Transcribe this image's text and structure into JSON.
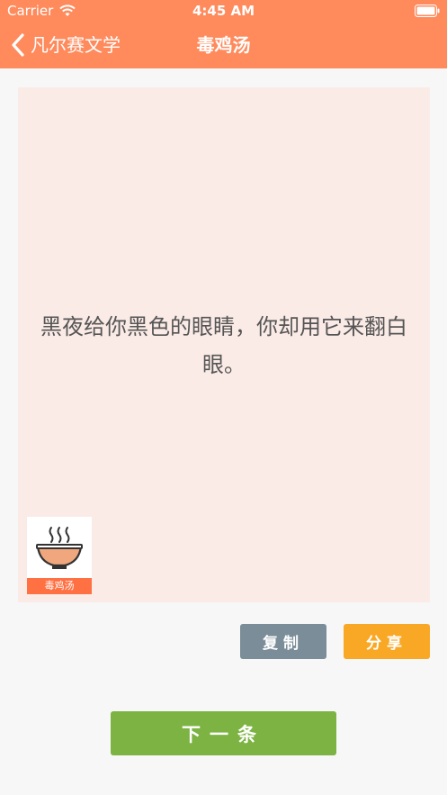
{
  "status_bar": {
    "carrier": "Carrier",
    "time": "4:45 AM"
  },
  "nav": {
    "back_label": "凡尔赛文学",
    "title": "毒鸡汤"
  },
  "quote": {
    "text": "黑夜给你黑色的眼睛，你却用它来翻白眼。"
  },
  "logo": {
    "label": "毒鸡汤"
  },
  "actions": {
    "copy_label": "复制",
    "share_label": "分享",
    "next_label": "下一条"
  },
  "colors": {
    "nav_background": "#ff8a5c",
    "card_background": "#fbebe6",
    "copy_button": "#7a8d98",
    "share_button": "#f9a825",
    "next_button": "#7cb342",
    "logo_band": "#ff7043"
  },
  "icons": {
    "back": "chevron-left-icon",
    "wifi": "wifi-icon",
    "battery": "battery-icon",
    "logo": "soup-bowl-icon"
  }
}
